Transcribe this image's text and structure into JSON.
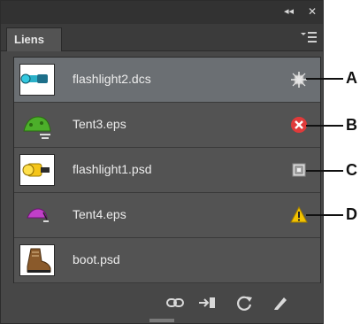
{
  "panel": {
    "tab_label": "Liens",
    "title_buttons": {
      "collapse": "◂◂",
      "close": "✕"
    }
  },
  "links": [
    {
      "name": "flashlight2.dcs",
      "status": "embedded",
      "selected": true
    },
    {
      "name": "Tent3.eps",
      "status": "missing"
    },
    {
      "name": "flashlight1.psd",
      "status": "non-native-art"
    },
    {
      "name": "Tent4.eps",
      "status": "modified"
    },
    {
      "name": "boot.psd",
      "status": "none"
    }
  ],
  "toolbar": {
    "tools": [
      "relink-icon",
      "go-to-link-icon",
      "update-link-icon",
      "edit-original-icon"
    ]
  },
  "callouts": [
    "A",
    "B",
    "C",
    "D"
  ],
  "colors": {
    "panel_bg": "#474747",
    "selected_row": "#6b6f73",
    "missing_red": "#e03a3a",
    "warning_yellow": "#f2c200"
  }
}
